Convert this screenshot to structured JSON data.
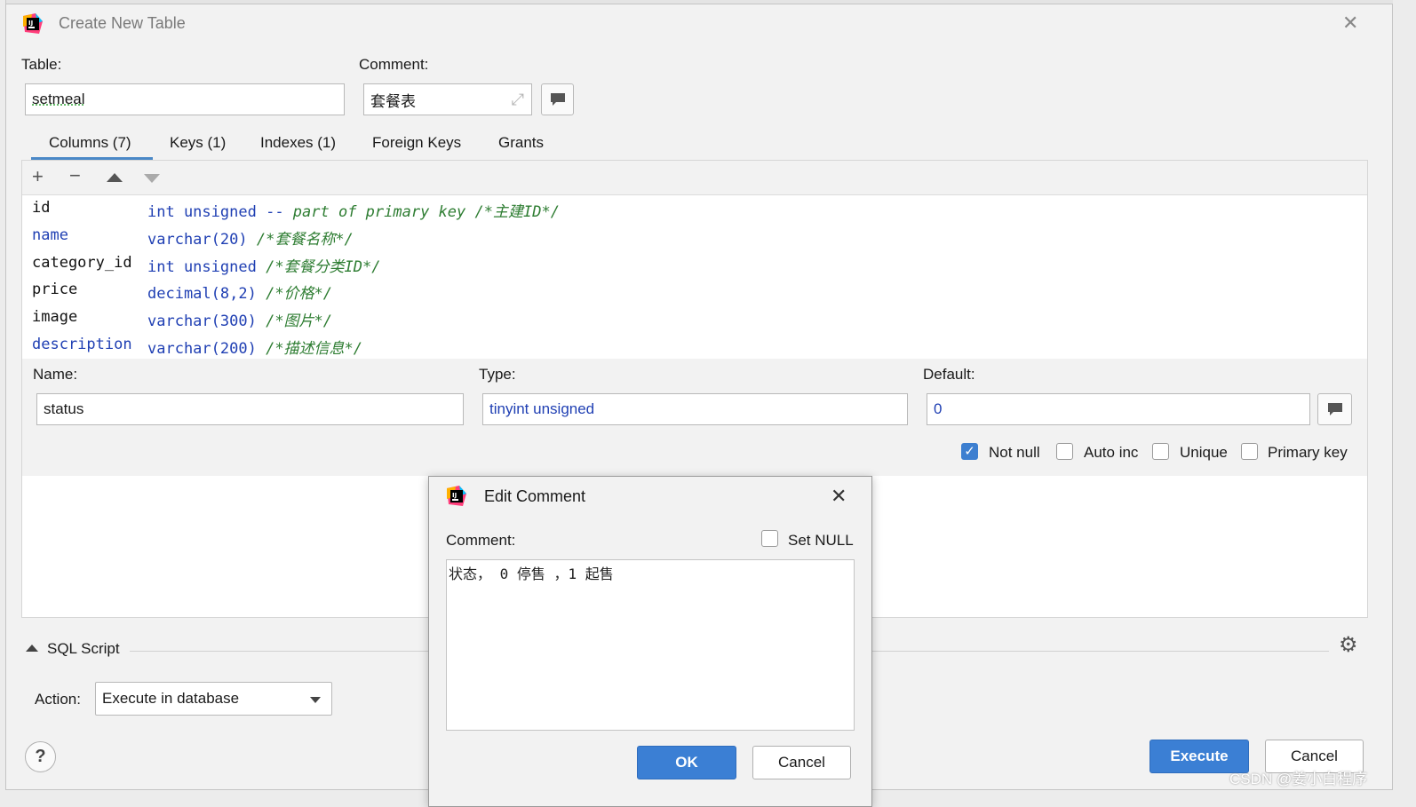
{
  "window": {
    "title": "Create New Table"
  },
  "table_label": "Table:",
  "table_value": "setmeal",
  "comment_label": "Comment:",
  "comment_value": "套餐表",
  "tabs": [
    {
      "label": "Columns (7)",
      "active": true
    },
    {
      "label": "Keys (1)"
    },
    {
      "label": "Indexes (1)"
    },
    {
      "label": "Foreign Keys"
    },
    {
      "label": "Grants"
    }
  ],
  "columns": [
    {
      "name": "id",
      "type": "int unsigned",
      "extra": "-- part of primary key",
      "comment": "/*主建ID*/"
    },
    {
      "name": "name",
      "type": "varchar(20)",
      "comment": "/*套餐名称*/"
    },
    {
      "name": "category_id",
      "type": "int unsigned",
      "comment": "/*套餐分类ID*/"
    },
    {
      "name": "price",
      "type": "decimal(8,2)",
      "comment": "/*价格*/"
    },
    {
      "name": "image",
      "type": "varchar(300)",
      "comment": "/*图片*/"
    },
    {
      "name": "description",
      "type": "varchar(200)",
      "comment": "/*描述信息*/"
    }
  ],
  "props": {
    "name_label": "Name:",
    "name_value": "status",
    "type_label": "Type:",
    "type_value": "tinyint unsigned",
    "default_label": "Default:",
    "default_value": "0",
    "not_null": "Not null",
    "auto_inc": "Auto inc",
    "unique": "Unique",
    "primary_key": "Primary key"
  },
  "sql_script": {
    "label": "SQL Script",
    "action_label": "Action:",
    "action_value": "Execute in database"
  },
  "buttons": {
    "execute": "Execute",
    "cancel": "Cancel",
    "help": "?"
  },
  "edit_comment": {
    "title": "Edit Comment",
    "comment_label": "Comment:",
    "set_null": "Set NULL",
    "text": "状态， 0 停售 ，1 起售",
    "ok": "OK",
    "cancel": "Cancel"
  },
  "watermark": "CSDN @姜小白程序"
}
